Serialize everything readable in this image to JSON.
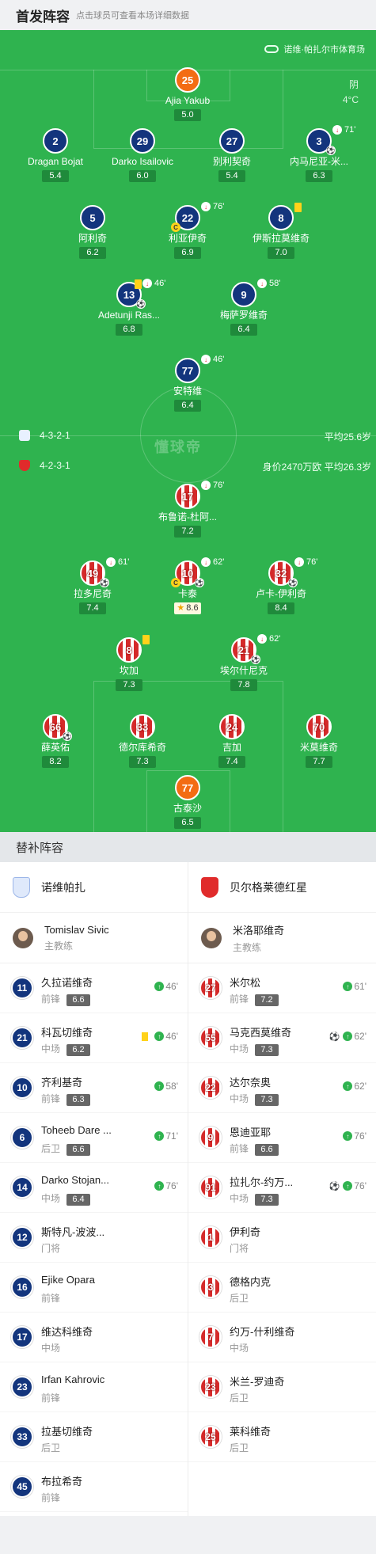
{
  "header": {
    "title": "首发阵容",
    "hint": "点击球员可查看本场详细数据"
  },
  "pitch": {
    "venue": "诺维·帕扎尔市体育场",
    "weather": "阴",
    "temp": "4°C",
    "home_formation": "4-3-2-1",
    "home_avg": "平均25.6岁",
    "away_formation": "4-2-3-1",
    "away_value": "身价2470万欧 平均26.3岁",
    "watermark": "懂球帝",
    "home": [
      {
        "num": "25",
        "name": "Ajia Yakub",
        "rating": "5.0",
        "gk": true
      },
      {
        "num": "2",
        "name": "Dragan Bojat",
        "rating": "5.4"
      },
      {
        "num": "29",
        "name": "Darko Isailovic",
        "rating": "6.0"
      },
      {
        "num": "27",
        "name": "别利契奇",
        "rating": "5.4"
      },
      {
        "num": "3",
        "name": "内马尼亚-米...",
        "rating": "6.3",
        "sub": "71'",
        "ball": true
      },
      {
        "num": "5",
        "name": "阿利奇",
        "rating": "6.2"
      },
      {
        "num": "22",
        "name": "利亚伊奇",
        "rating": "6.9",
        "sub": "76'",
        "cap": true
      },
      {
        "num": "8",
        "name": "伊斯拉莫维奇",
        "rating": "7.0",
        "yc": true
      },
      {
        "num": "13",
        "name": "Adetunji Ras...",
        "rating": "6.8",
        "sub": "46'",
        "yc": true,
        "ball": true
      },
      {
        "num": "9",
        "name": "梅萨罗维奇",
        "rating": "6.4",
        "sub": "58'"
      },
      {
        "num": "77",
        "name": "安特维",
        "rating": "6.4",
        "sub": "46'"
      }
    ],
    "away": [
      {
        "num": "17",
        "name": "布鲁诺-杜阿...",
        "rating": "7.2",
        "sub": "76'"
      },
      {
        "num": "49",
        "name": "拉多尼奇",
        "rating": "7.4",
        "sub": "61'",
        "ball": true
      },
      {
        "num": "10",
        "name": "卡泰",
        "rating": "8.6",
        "sub": "62'",
        "cap": true,
        "ball": true,
        "star": true
      },
      {
        "num": "32",
        "name": "卢卡-伊利奇",
        "rating": "8.4",
        "sub": "76'",
        "ball": true
      },
      {
        "num": "8",
        "name": "坎加",
        "rating": "7.3",
        "yc": true
      },
      {
        "num": "21",
        "name": "埃尔什尼克",
        "rating": "7.8",
        "sub": "62'",
        "ball": true
      },
      {
        "num": "66",
        "name": "薛英佑",
        "rating": "8.2",
        "ball": true
      },
      {
        "num": "33",
        "name": "德尔库希奇",
        "rating": "7.3"
      },
      {
        "num": "24",
        "name": "吉加",
        "rating": "7.4"
      },
      {
        "num": "70",
        "name": "米莫维奇",
        "rating": "7.7"
      },
      {
        "num": "77",
        "name": "古泰沙",
        "rating": "6.5",
        "gk": true
      }
    ]
  },
  "subs": {
    "title": "替补阵容",
    "home": {
      "team": "诺维帕扎",
      "coach": {
        "name": "Tomislav Sivic",
        "role": "主教练"
      },
      "players": [
        {
          "num": "11",
          "name": "久拉诺维奇",
          "pos": "前锋",
          "rating": "6.6",
          "min": "46'"
        },
        {
          "num": "21",
          "name": "科瓦切维奇",
          "pos": "中场",
          "rating": "6.2",
          "min": "46'",
          "yc": true
        },
        {
          "num": "10",
          "name": "齐利基奇",
          "pos": "前锋",
          "rating": "6.3",
          "min": "58'"
        },
        {
          "num": "6",
          "name": "Toheeb Dare ...",
          "pos": "后卫",
          "rating": "6.6",
          "min": "71'"
        },
        {
          "num": "14",
          "name": "Darko Stojan...",
          "pos": "中场",
          "rating": "6.4",
          "min": "76'"
        },
        {
          "num": "12",
          "name": "斯特凡-波波...",
          "pos": "门将"
        },
        {
          "num": "16",
          "name": "Ejike Opara",
          "pos": "前锋"
        },
        {
          "num": "17",
          "name": "维达科维奇",
          "pos": "中场"
        },
        {
          "num": "23",
          "name": "Irfan Kahrovic",
          "pos": "前锋"
        },
        {
          "num": "33",
          "name": "拉基切维奇",
          "pos": "后卫"
        },
        {
          "num": "45",
          "name": "布拉希奇",
          "pos": "前锋"
        }
      ]
    },
    "away": {
      "team": "贝尔格莱德红星",
      "coach": {
        "name": "米洛耶维奇",
        "role": "主教练"
      },
      "players": [
        {
          "num": "27",
          "name": "米尔松",
          "pos": "前锋",
          "rating": "7.2",
          "min": "61'"
        },
        {
          "num": "55",
          "name": "马克西莫维奇",
          "pos": "中场",
          "rating": "7.3",
          "min": "62'",
          "ball": true
        },
        {
          "num": "22",
          "name": "达尔奈奥",
          "pos": "中场",
          "rating": "7.3",
          "min": "62'"
        },
        {
          "num": "9",
          "name": "恩迪亚耶",
          "pos": "前锋",
          "rating": "6.6",
          "min": "76'"
        },
        {
          "num": "91",
          "name": "拉扎尔-约万...",
          "pos": "中场",
          "rating": "7.3",
          "min": "76'",
          "ball": true
        },
        {
          "num": "1",
          "name": "伊利奇",
          "pos": "门将"
        },
        {
          "num": "3",
          "name": "德格内克",
          "pos": "后卫"
        },
        {
          "num": "7",
          "name": "约万-什利维奇",
          "pos": "中场"
        },
        {
          "num": "23",
          "name": "米兰-罗迪奇",
          "pos": "后卫"
        },
        {
          "num": "25",
          "name": "莱科维奇",
          "pos": "后卫"
        }
      ]
    }
  }
}
